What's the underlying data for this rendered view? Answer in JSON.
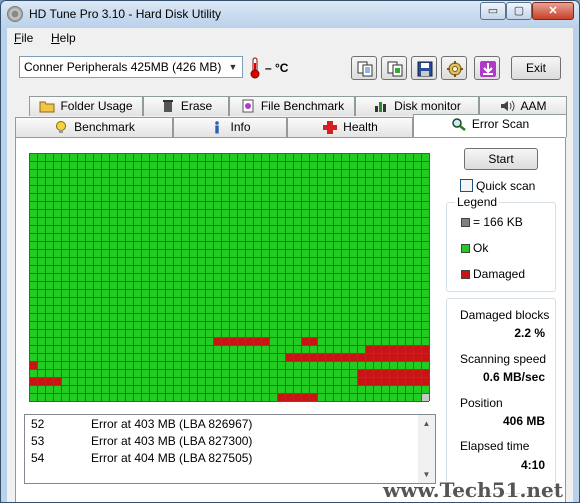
{
  "window": {
    "title": "HD Tune Pro 3.10 - Hard Disk Utility",
    "minimize_label": "▭",
    "maximize_label": "▢",
    "close_label": "✕"
  },
  "menu": {
    "file": {
      "accel": "F",
      "rest": "ile"
    },
    "help": {
      "accel": "H",
      "rest": "elp"
    }
  },
  "toolbar": {
    "drive_selected": "Conner Peripherals 425MB (426 MB)",
    "temperature": "– °C",
    "exit_label": "Exit",
    "buttons": [
      "copy-info-icon",
      "copy-screenshot-icon",
      "save-icon",
      "options-icon",
      "download-icon"
    ]
  },
  "tabs": {
    "row1": [
      "Folder Usage",
      "Erase",
      "File Benchmark",
      "Disk monitor",
      "AAM"
    ],
    "row2": [
      "Benchmark",
      "Info",
      "Health",
      "Error Scan"
    ],
    "active": "Error Scan"
  },
  "scan": {
    "start_label": "Start",
    "quick_scan_label": "Quick scan",
    "quick_scan_checked": false
  },
  "legend": {
    "title": "Legend",
    "block_size": "= 166 KB",
    "ok": "Ok",
    "damaged": "Damaged"
  },
  "stats": {
    "damaged_blocks_label": "Damaged blocks",
    "damaged_blocks_value": "2.2 %",
    "scanning_speed_label": "Scanning speed",
    "scanning_speed_value": "0.6 MB/sec",
    "position_label": "Position",
    "position_value": "406 MB",
    "elapsed_label": "Elapsed time",
    "elapsed_value": "4:10"
  },
  "log": [
    {
      "num": "52",
      "msg": "Error at 403 MB (LBA 826967)"
    },
    {
      "num": "53",
      "msg": "Error at 403 MB (LBA 827300)"
    },
    {
      "num": "54",
      "msg": "Error at 404 MB (LBA 827505)"
    }
  ],
  "colors": {
    "ok": "#22cc22",
    "damaged": "#c81414",
    "grid_line": "#1e7a1e",
    "unused": "#c8c8c8"
  },
  "watermark": "www.Tech51.net"
}
